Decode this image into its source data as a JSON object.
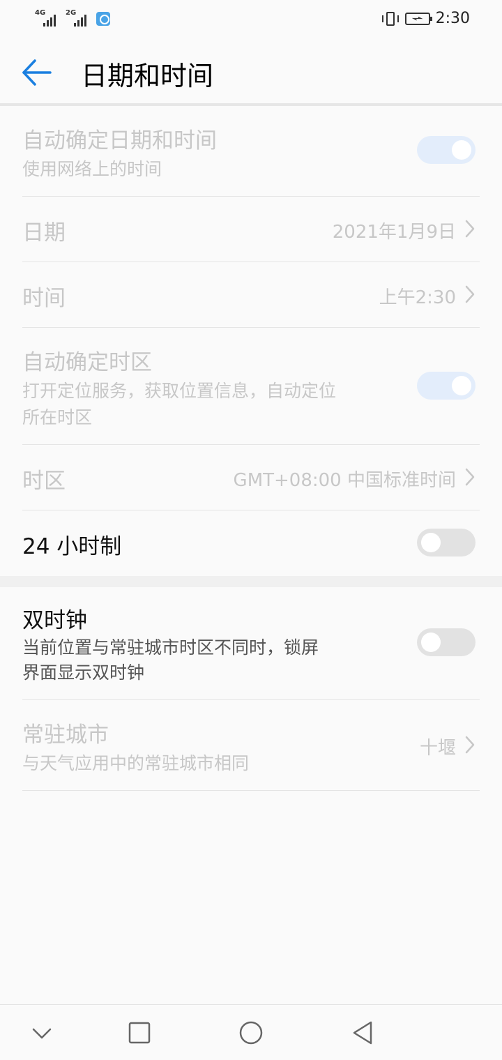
{
  "status_bar": {
    "net1": "4G",
    "net2": "2G",
    "time": "2:30"
  },
  "header": {
    "title": "日期和时间",
    "back_icon": "arrow-left-icon"
  },
  "settings": {
    "auto_datetime": {
      "title": "自动确定日期和时间",
      "subtitle": "使用网络上的时间",
      "enabled": true
    },
    "date": {
      "title": "日期",
      "value": "2021年1月9日"
    },
    "time": {
      "title": "时间",
      "value": "上午2:30"
    },
    "auto_timezone": {
      "title": "自动确定时区",
      "subtitle_line1": "打开定位服务，获取位置信息，自动定位",
      "subtitle_line2": "所在时区",
      "enabled": true
    },
    "timezone": {
      "title": "时区",
      "value": "GMT+08:00 中国标准时间"
    },
    "hour24": {
      "title": "24 小时制",
      "enabled": false
    },
    "dual_clock": {
      "title": "双时钟",
      "subtitle_line1": "当前位置与常驻城市时区不同时，锁屏",
      "subtitle_line2": "界面显示双时钟",
      "enabled": false
    },
    "home_city": {
      "title": "常驻城市",
      "subtitle": "与天气应用中的常驻城市相同",
      "value": "十堰"
    }
  },
  "nav_bar": {
    "icons": [
      "chevron-down-icon",
      "square-icon",
      "circle-icon",
      "triangle-back-icon"
    ]
  },
  "colors": {
    "accent": "#1a7fe0",
    "disabled_text": "#c7c7c7",
    "toggle_on_disabled": "#e3edfb",
    "toggle_off": "#e2e2e2"
  }
}
